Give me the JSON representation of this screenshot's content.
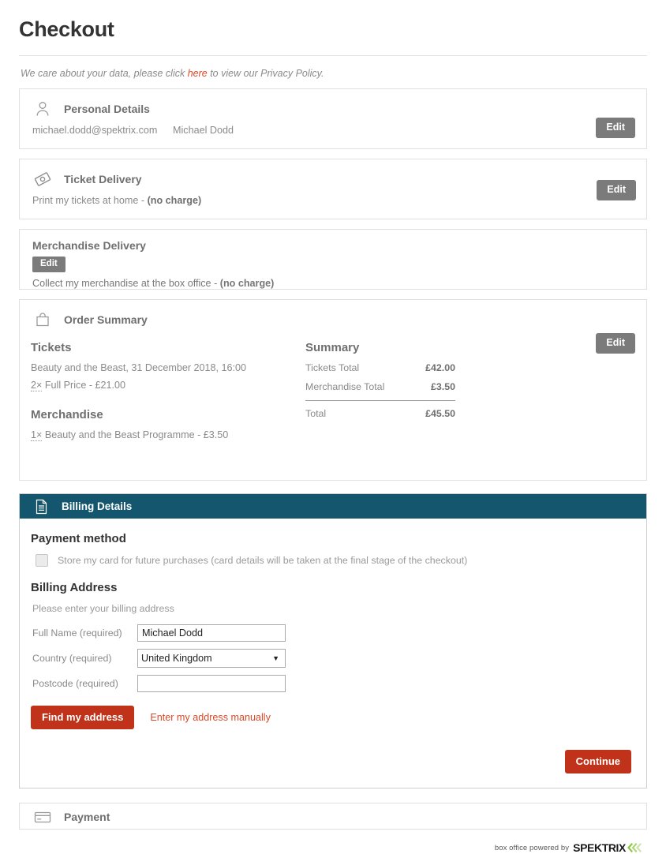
{
  "page": {
    "title": "Checkout",
    "privacy_prefix": "We care about your data, please click ",
    "privacy_link": "here",
    "privacy_suffix": " to view our Privacy Policy."
  },
  "personal_details": {
    "icon": "user-icon",
    "title": "Personal Details",
    "email": "michael.dodd@spektrix.com",
    "name": "Michael Dodd",
    "edit_label": "Edit"
  },
  "ticket_delivery": {
    "icon": "ticket-icon",
    "title": "Ticket Delivery",
    "method_text": "Print my tickets at home - ",
    "method_charge": "(no charge)",
    "edit_label": "Edit"
  },
  "merchandise_delivery": {
    "title": "Merchandise Delivery",
    "edit_label": "Edit",
    "method_text": "Collect my merchandise at the box office - ",
    "method_charge": "(no charge)"
  },
  "order_summary": {
    "icon": "shopping-bag-icon",
    "title": "Order Summary",
    "edit_label": "Edit",
    "tickets_heading": "Tickets",
    "event_line": "Beauty and the Beast, 31 December 2018, 16:00",
    "ticket_qty": "2×",
    "ticket_line": " Full Price - £21.00",
    "merchandise_heading": "Merchandise",
    "merch_qty": "1×",
    "merch_line": " Beauty and the Beast Programme - £3.50",
    "summary_heading": "Summary",
    "rows": [
      {
        "label": "Tickets Total",
        "amount": "£42.00"
      },
      {
        "label": "Merchandise Total",
        "amount": "£3.50"
      }
    ],
    "total_label": "Total",
    "total_amount": "£45.50"
  },
  "billing_details": {
    "icon": "document-icon",
    "title": "Billing Details",
    "header_color": "#14566d",
    "payment_method_heading": "Payment method",
    "store_card_label": "Store my card for future purchases (card details will be taken at the final stage of the checkout)",
    "store_card_checked": false,
    "billing_address_heading": "Billing Address",
    "billing_address_hint": "Please enter your billing address",
    "fields": [
      {
        "label": "Full Name (required)",
        "value": "Michael Dodd",
        "placeholder": ""
      },
      {
        "label": "Country (required)",
        "value": "United Kingdom"
      },
      {
        "label": "Postcode (required)",
        "value": "",
        "placeholder": ""
      }
    ],
    "find_address_label": "Find my address",
    "manual_address_label": "Enter my address manually",
    "continue_label": "Continue",
    "accent_red": "#c0331a",
    "link_red": "#d94a28"
  },
  "payment": {
    "icon": "credit-card-icon",
    "title": "Payment"
  },
  "footer": {
    "powered_by": "box office powered by",
    "brand": "SPEKTRIX",
    "chevron_color": "#8cc63f"
  }
}
